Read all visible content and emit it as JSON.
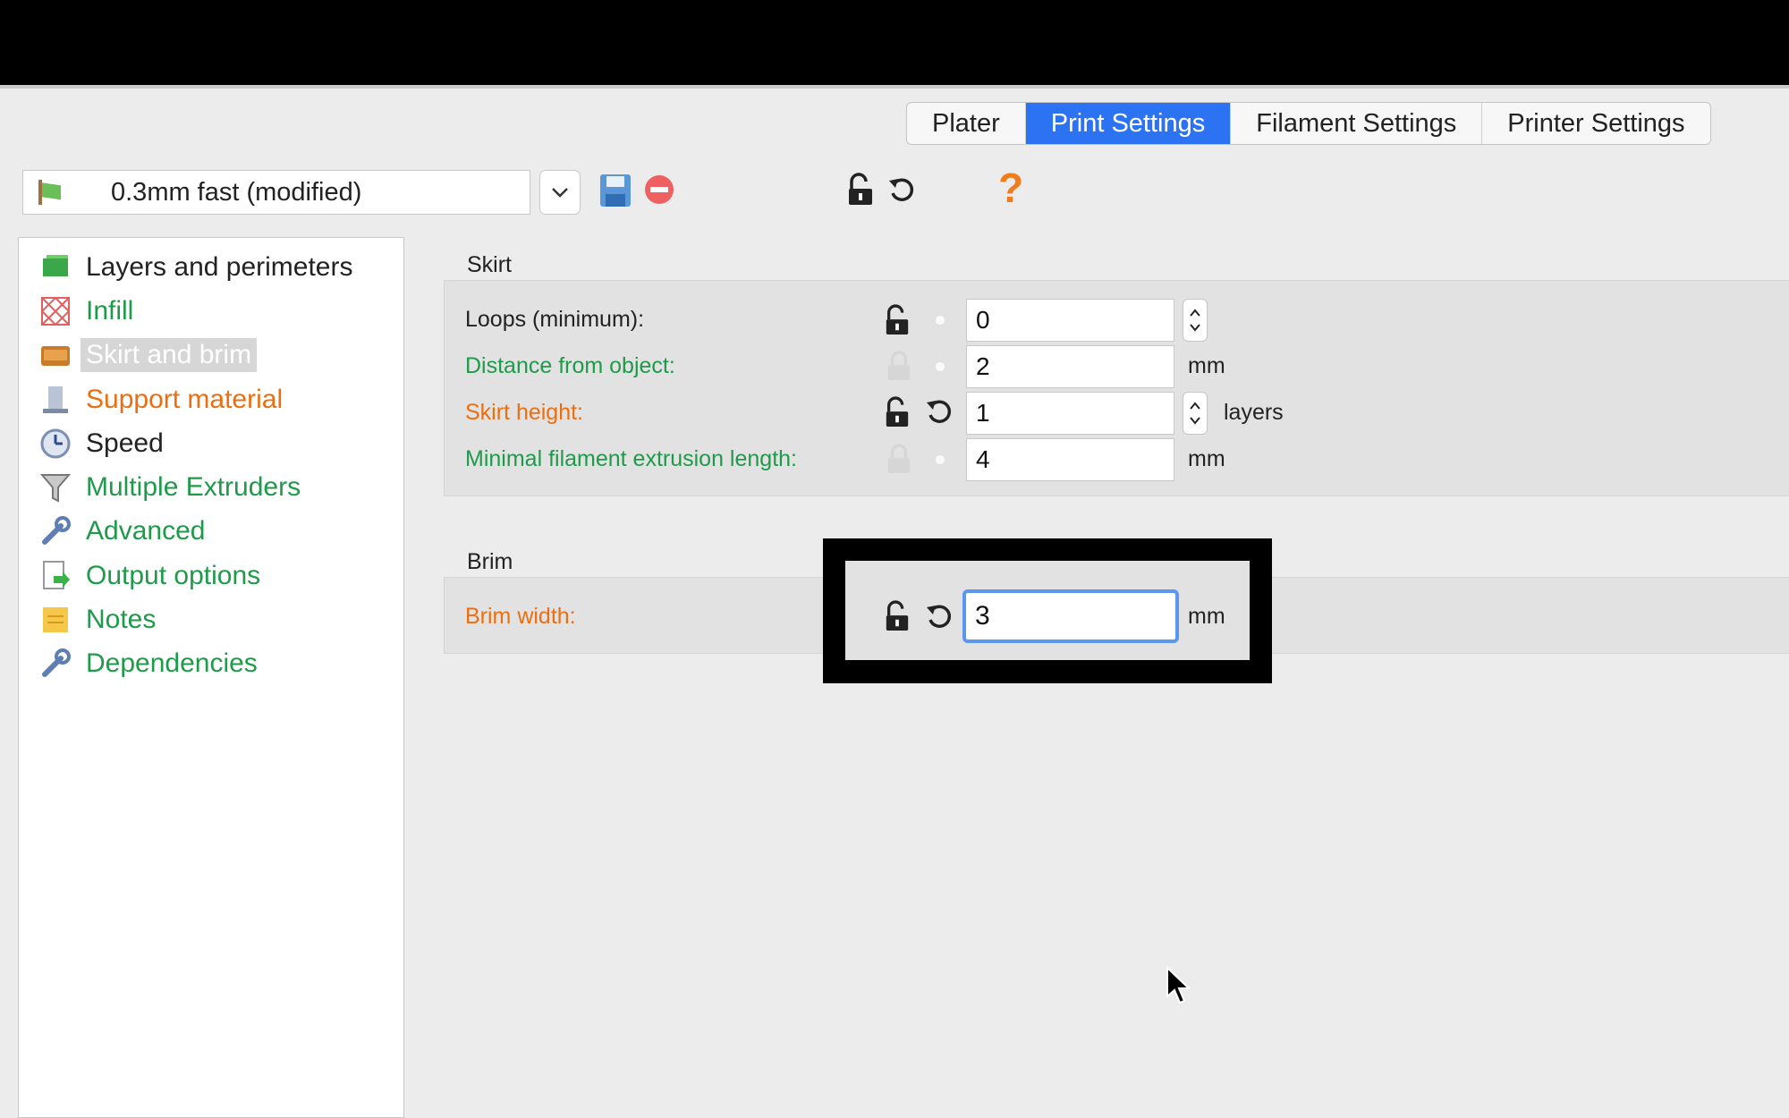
{
  "tabs": [
    "Plater",
    "Print Settings",
    "Filament Settings",
    "Printer Settings"
  ],
  "active_tab": "Print Settings",
  "preset": {
    "name": "0.3mm fast (modified)"
  },
  "help_label": "?",
  "sidebar": {
    "items": [
      {
        "label": "Layers and perimeters",
        "color": "#222222",
        "icon": "layers-icon"
      },
      {
        "label": "Infill",
        "color": "#1f9a4a",
        "icon": "infill-icon"
      },
      {
        "label": "Skirt and brim",
        "color": "#ffffff",
        "icon": "skirt-brim-icon",
        "selected": true
      },
      {
        "label": "Support material",
        "color": "#ea6f12",
        "icon": "support-icon"
      },
      {
        "label": "Speed",
        "color": "#222222",
        "icon": "speed-icon"
      },
      {
        "label": "Multiple Extruders",
        "color": "#1f9a4a",
        "icon": "funnel-icon"
      },
      {
        "label": "Advanced",
        "color": "#1f9a4a",
        "icon": "wrench-icon"
      },
      {
        "label": "Output options",
        "color": "#1f9a4a",
        "icon": "output-icon"
      },
      {
        "label": "Notes",
        "color": "#1f9a4a",
        "icon": "notes-icon"
      },
      {
        "label": "Dependencies",
        "color": "#1f9a4a",
        "icon": "wrench-icon"
      }
    ]
  },
  "skirt": {
    "title": "Skirt",
    "rows": [
      {
        "label": "Loops (minimum):",
        "value": "0",
        "unit": ""
      },
      {
        "label": "Distance from object:",
        "value": "2",
        "unit": "mm"
      },
      {
        "label": "Skirt height:",
        "value": "1",
        "unit": "layers"
      },
      {
        "label": "Minimal filament extrusion length:",
        "value": "4",
        "unit": "mm"
      }
    ]
  },
  "brim": {
    "title": "Brim",
    "rows": [
      {
        "label": "Brim width:",
        "value": "3",
        "unit": "mm"
      }
    ]
  },
  "colors": {
    "accent": "#2b73f2",
    "modified_system": "#1f9a4a",
    "modified_user": "#ea6f12",
    "help": "#f07c1e"
  }
}
